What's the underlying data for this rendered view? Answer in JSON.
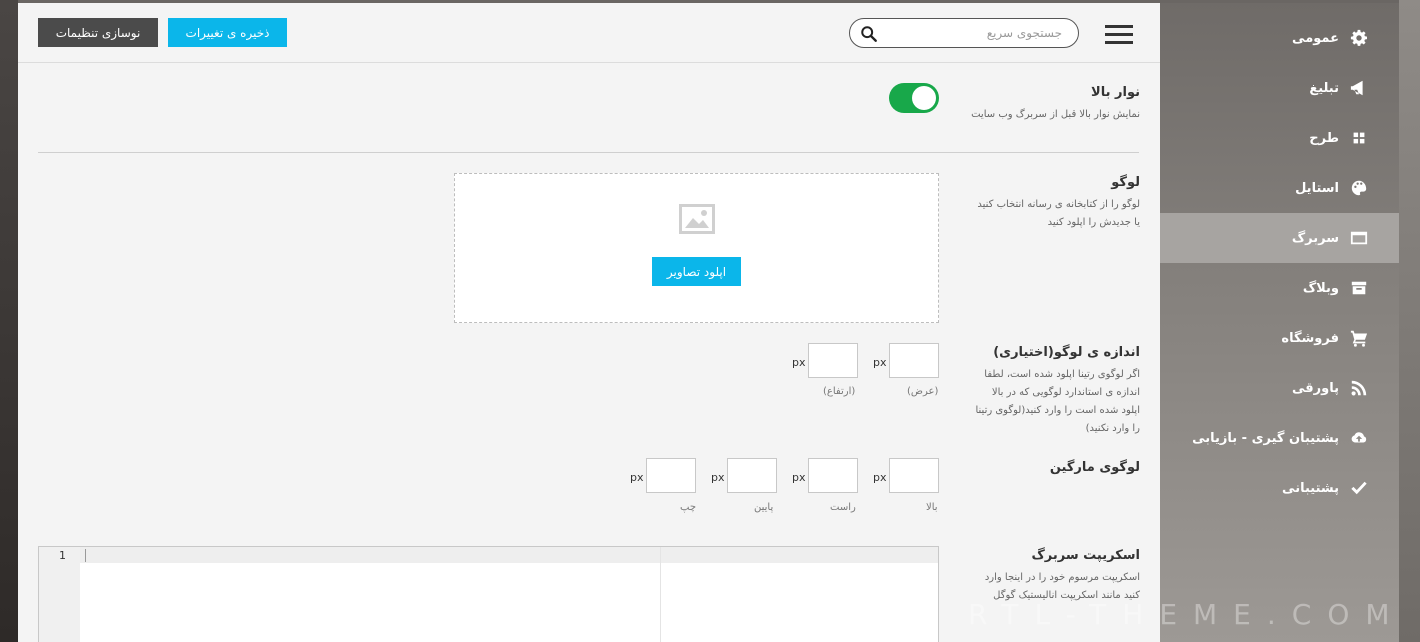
{
  "toolbar": {
    "reset_label": "نوسازی تنظیمات",
    "save_label": "ذخیره ی تغییرات",
    "search_placeholder": "جستجوی سریع"
  },
  "sidebar": {
    "items": [
      {
        "label": "عمومی",
        "icon": "gear-icon"
      },
      {
        "label": "تبلیغ",
        "icon": "megaphone-icon"
      },
      {
        "label": "طرح",
        "icon": "grid-icon"
      },
      {
        "label": "استایل",
        "icon": "palette-icon"
      },
      {
        "label": "سربرگ",
        "icon": "browser-window-icon",
        "active": true
      },
      {
        "label": "وبلاگ",
        "icon": "archive-box-icon"
      },
      {
        "label": "فروشگاه",
        "icon": "cart-icon"
      },
      {
        "label": "پاورقی",
        "icon": "rss-icon"
      },
      {
        "label": "پشتیبان گیری - بازیابی",
        "icon": "cloud-upload-icon"
      },
      {
        "label": "پشتیبانی",
        "icon": "check-icon"
      }
    ]
  },
  "topbar_setting": {
    "title": "نوار بالا",
    "desc": "نمایش نوار بالا قبل از سربرگ وب سایت",
    "enabled": true
  },
  "logo": {
    "title": "لوگو",
    "desc_line1": "لوگو را از کتابخانه ی رسانه انتخاب کنید",
    "desc_line2": "یا جدیدش را اپلود کنید",
    "upload_label": "اپلود تصاویر"
  },
  "logo_size": {
    "title": "اندازه ی لوگو(اختیاری)",
    "desc_line1": "اگر لوگوی رتینا اپلود شده است، لطفا",
    "desc_line2": "اندازه ی استاندارد لوگویی که در بالا",
    "desc_line3": "اپلود شده است را وارد کنید(لوگوی رتینا",
    "desc_line4": "را وارد نکنید)",
    "unit": "px",
    "width_caption": "(عرض)",
    "height_caption": "(ارتفاع)"
  },
  "logo_margin": {
    "title": "لوگوی مارگین",
    "unit": "px",
    "top_caption": "بالا",
    "right_caption": "راست",
    "bottom_caption": "پایین",
    "left_caption": "چپ"
  },
  "header_script": {
    "title": "اسکریپت سربرگ",
    "desc_line1": "اسکریپت مرسوم خود را در اینجا وارد",
    "desc_line2": "کنید مانند اسکریپت انالیستیک گوگل",
    "line_number": "1"
  },
  "watermark": "RTL-THEME.COM"
}
